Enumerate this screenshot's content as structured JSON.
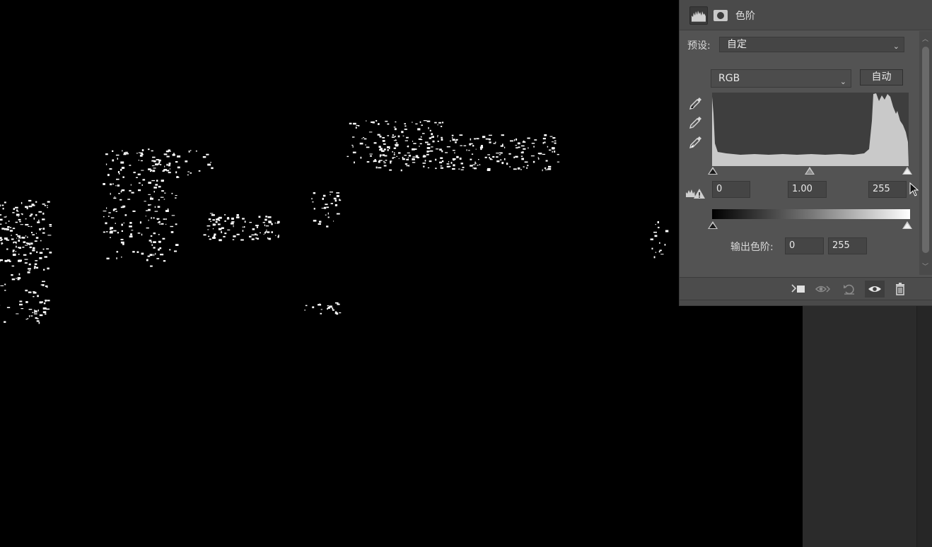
{
  "panel": {
    "title": "色阶",
    "tab_icons": [
      "levels-histogram-icon",
      "mask-icon"
    ]
  },
  "preset": {
    "label": "预设:",
    "value": "自定"
  },
  "channel": {
    "value": "RGB"
  },
  "auto_button": {
    "label": "自动"
  },
  "eyedroppers": [
    "black-point-eyedropper-icon",
    "gray-point-eyedropper-icon",
    "white-point-eyedropper-icon"
  ],
  "input_levels": {
    "black": "0",
    "gamma": "1.00",
    "white": "255"
  },
  "output_levels": {
    "label": "输出色阶:",
    "black": "0",
    "white": "255"
  },
  "footer_buttons": [
    "clip-to-layer-icon",
    "view-previous-state-icon",
    "reset-icon",
    "visibility-eye-icon",
    "trash-icon"
  ],
  "colors": {
    "panel_bg": "#535353",
    "canvas_bg": "#000000",
    "histogram_bg": "#3e3e3e",
    "histogram_fill": "#c9c9c9"
  }
}
